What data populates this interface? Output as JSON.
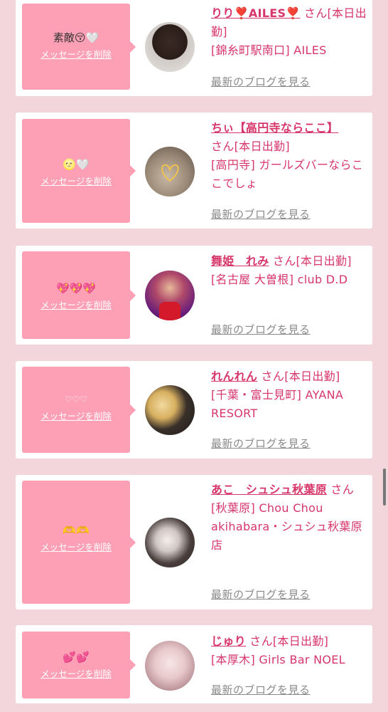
{
  "delete_label": "メッセージを削除",
  "blog_label": "最新のブログを見る",
  "cards": [
    {
      "message": "素敵😚🤍",
      "name": "りり❣️AILES❣️",
      "suffix": " さん[本日出勤]",
      "store": "[錦糸町駅南口] AILES"
    },
    {
      "message": "🌝🤍",
      "name": "ちぃ【高円寺ならここ】",
      "suffix": " さん[本日出勤]",
      "store": "[高円寺] ガールズバーならここでしょ"
    },
    {
      "message": "💖💖💖",
      "name": "舞姫　れみ",
      "suffix": " さん[本日出勤]",
      "store": "[名古屋 大曽根] club D.D"
    },
    {
      "message": "♡♡♡",
      "name": "れんれん",
      "suffix": " さん[本日出勤]",
      "store": "[千葉・富士見町] AYANA RESORT"
    },
    {
      "message": "🫶🫶",
      "name": "あこ　シュシュ秋葉原",
      "suffix": " さん",
      "store": "[秋葉原] Chou Chou akihabara・シュシュ秋葉原店"
    },
    {
      "message": "💕💕",
      "name": "じゅり",
      "suffix": " さん[本日出勤]",
      "store": "[本厚木] Girls Bar NOEL"
    }
  ],
  "colors": {
    "accent": "#d6366a",
    "message_bg": "#fda0b5",
    "page_bg": "#f3d5dc"
  }
}
